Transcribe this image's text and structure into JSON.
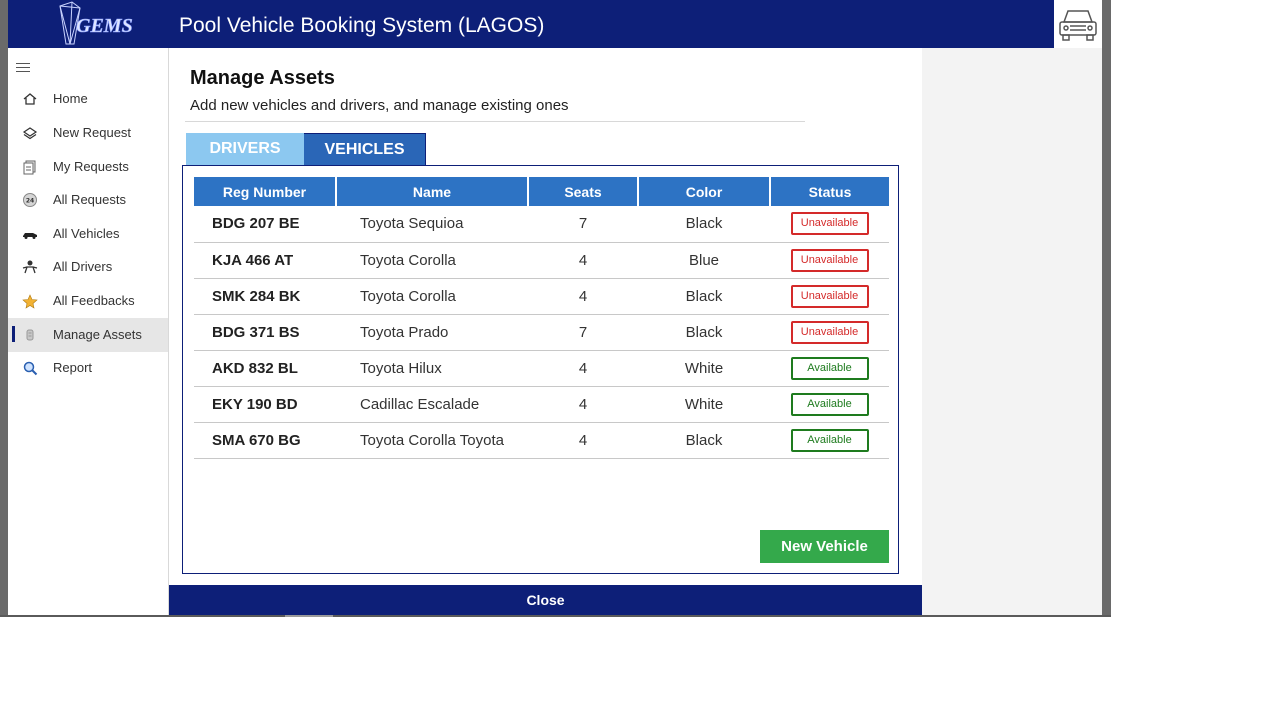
{
  "header": {
    "title": "Pool Vehicle Booking System (LAGOS)",
    "logo_text": "GEMS",
    "bg_color": "#0d1f78"
  },
  "sidebar": {
    "items": [
      {
        "label": "Home",
        "icon": "home-icon"
      },
      {
        "label": "New Request",
        "icon": "layers-icon"
      },
      {
        "label": "My Requests",
        "icon": "documents-icon"
      },
      {
        "label": "All Requests",
        "icon": "clock-24-icon"
      },
      {
        "label": "All Vehicles",
        "icon": "car-icon"
      },
      {
        "label": "All Drivers",
        "icon": "drivers-icon"
      },
      {
        "label": "All Feedbacks",
        "icon": "star-icon"
      },
      {
        "label": "Manage Assets",
        "icon": "asset-icon",
        "active": true
      },
      {
        "label": "Report",
        "icon": "magnifier-icon"
      }
    ]
  },
  "page": {
    "title": "Manage Assets",
    "subtitle": "Add new vehicles and drivers, and manage existing ones"
  },
  "tabs": {
    "drivers": "DRIVERS",
    "vehicles": "VEHICLES",
    "active": "vehicles"
  },
  "table": {
    "headers": {
      "reg": "Reg Number",
      "name": "Name",
      "seats": "Seats",
      "color": "Color",
      "status": "Status"
    },
    "rows": [
      {
        "reg": "BDG 207 BE",
        "name": "Toyota Sequioa",
        "seats": "7",
        "color": "Black",
        "status": "Unavailable"
      },
      {
        "reg": "KJA 466 AT",
        "name": "Toyota Corolla",
        "seats": "4",
        "color": "Blue",
        "status": "Unavailable"
      },
      {
        "reg": "SMK 284 BK",
        "name": "Toyota Corolla",
        "seats": "4",
        "color": "Black",
        "status": "Unavailable"
      },
      {
        "reg": "BDG 371 BS",
        "name": "Toyota Prado",
        "seats": "7",
        "color": "Black",
        "status": "Unavailable"
      },
      {
        "reg": "AKD 832 BL",
        "name": "Toyota Hilux",
        "seats": "4",
        "color": "White",
        "status": "Available"
      },
      {
        "reg": "EKY 190 BD",
        "name": "Cadillac Escalade",
        "seats": "4",
        "color": "White",
        "status": "Available"
      },
      {
        "reg": "SMA 670 BG",
        "name": "Toyota Corolla Toyota",
        "seats": "4",
        "color": "Black",
        "status": "Available"
      }
    ]
  },
  "buttons": {
    "new_vehicle": "New Vehicle",
    "close": "Close"
  },
  "colors": {
    "accent_blue": "#2d73c4",
    "tab_inactive": "#8cc8f0",
    "available": "#1e7b1e",
    "unavailable": "#d42a2a",
    "new_button": "#34a94b"
  }
}
